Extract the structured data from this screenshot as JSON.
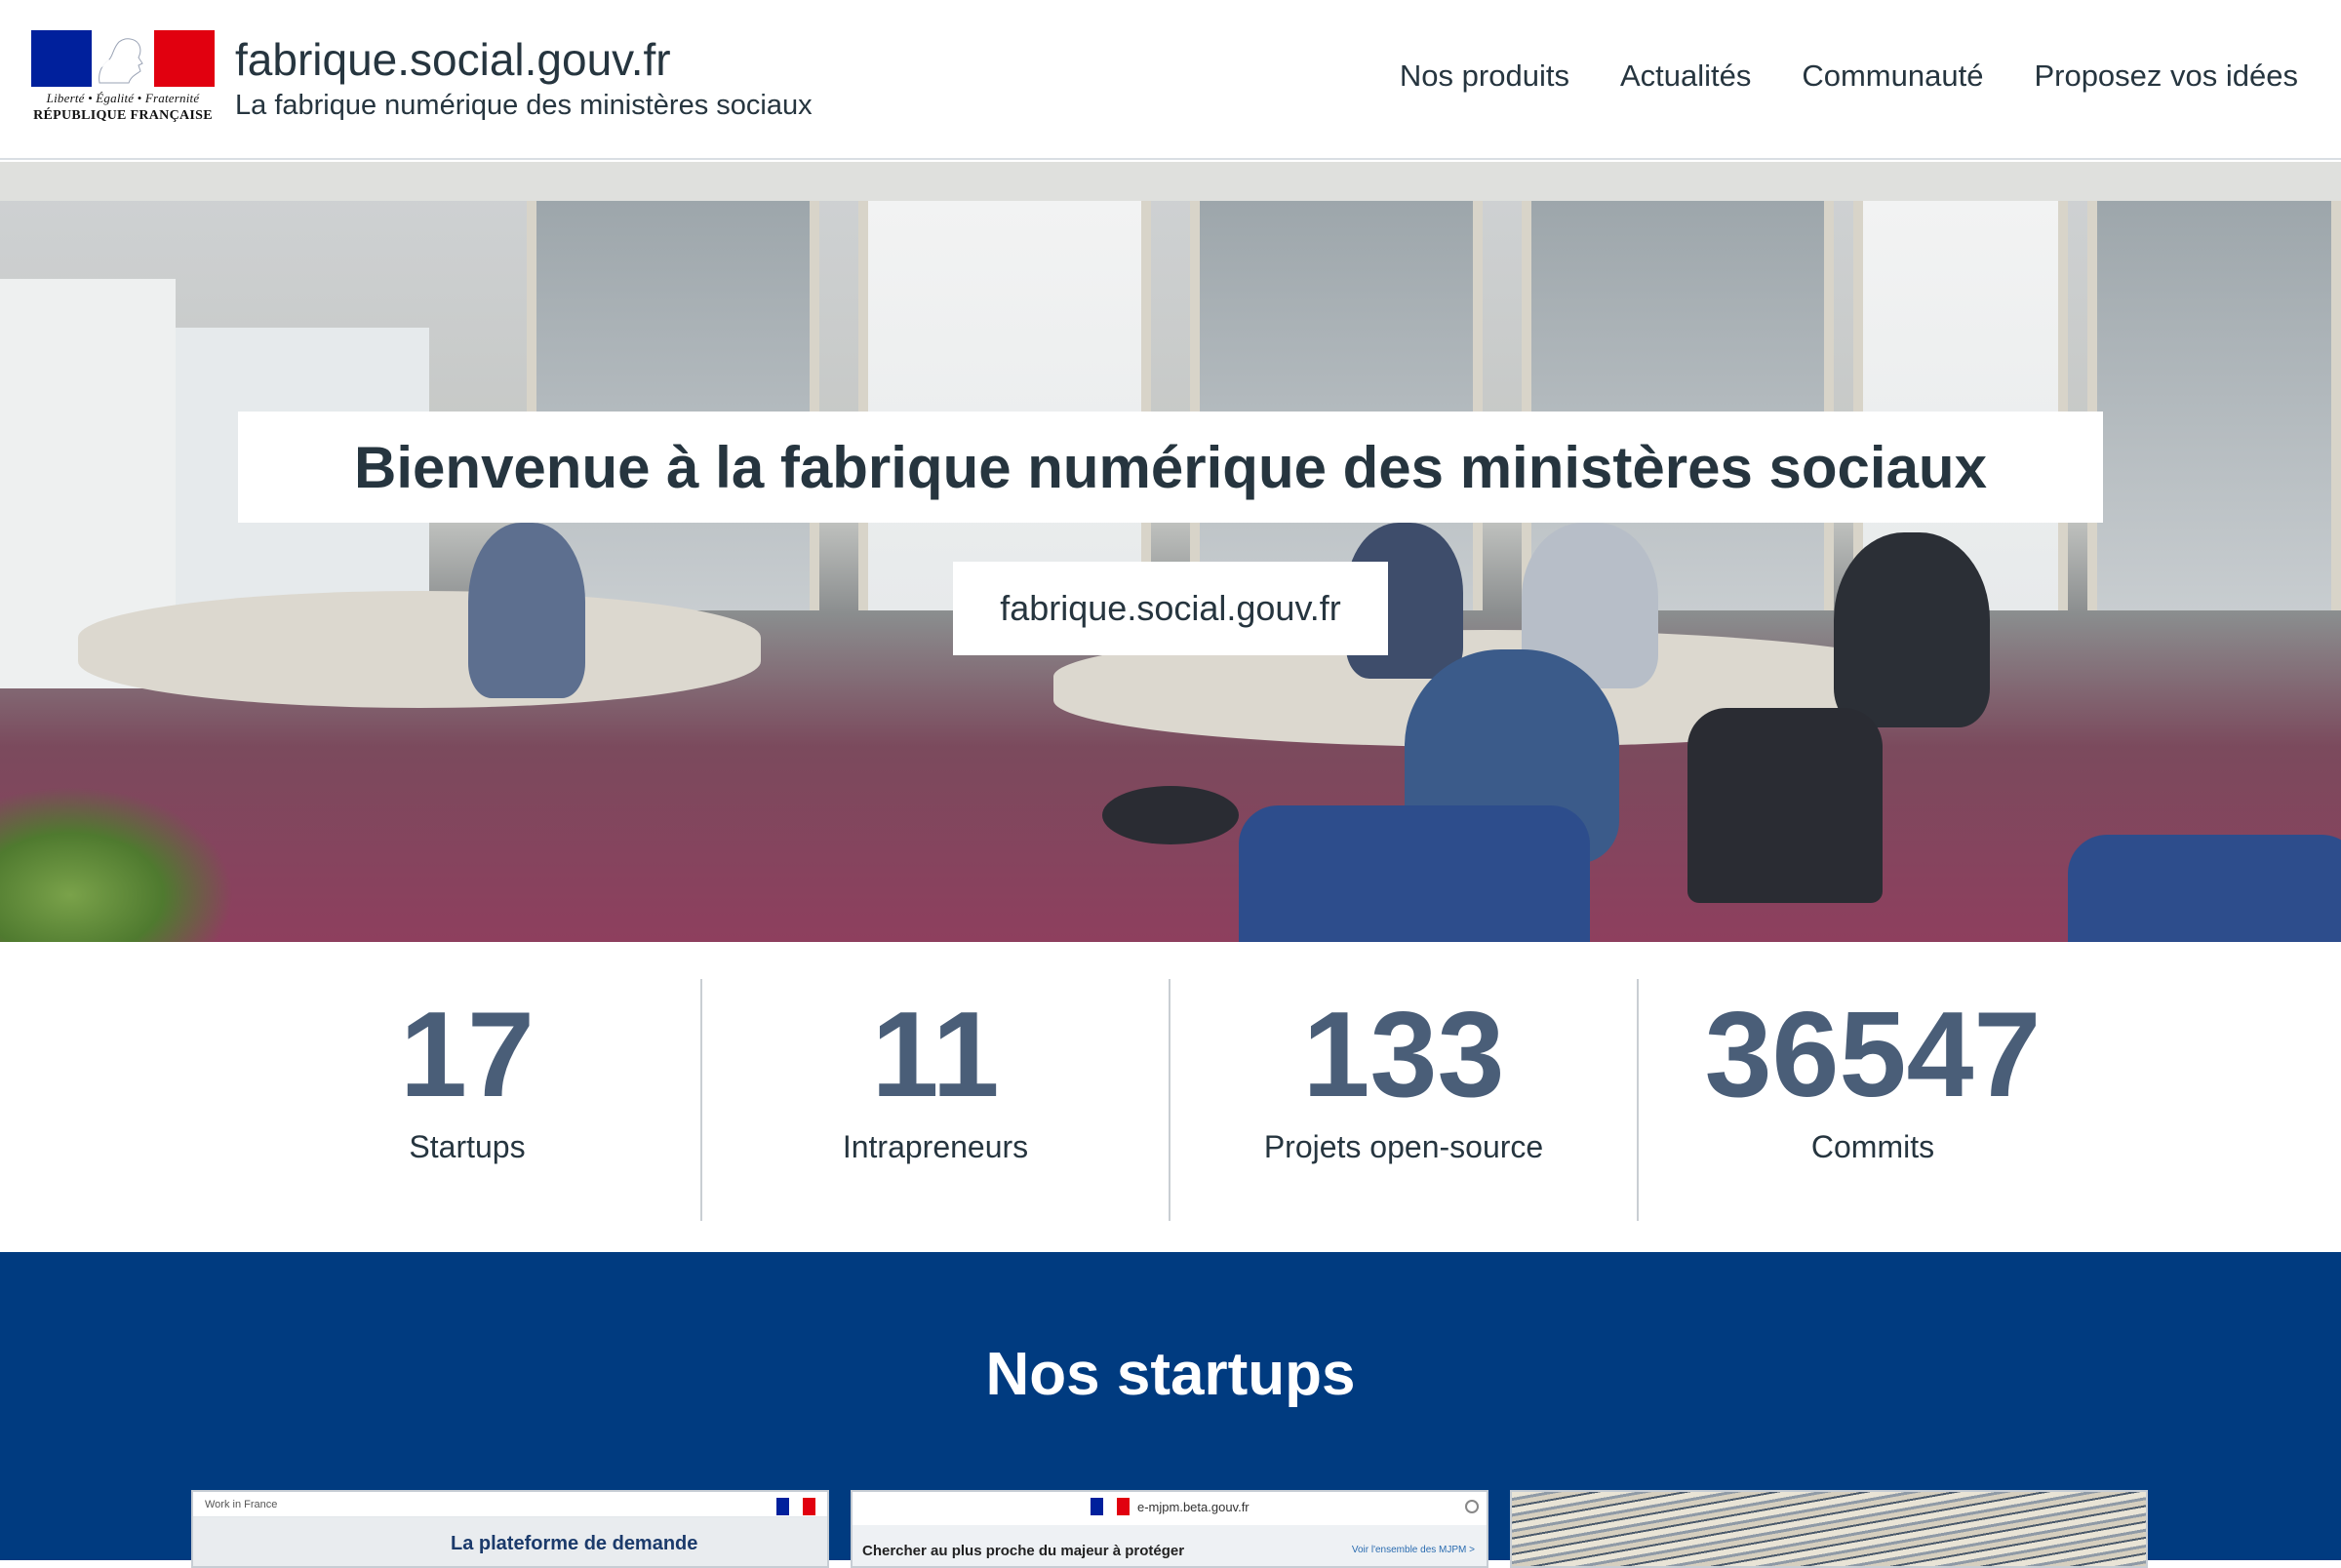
{
  "header": {
    "logo": {
      "devise": "Liberté • Égalité • Fraternité",
      "republique": "RÉPUBLIQUE FRANÇAISE"
    },
    "site_title": "fabrique.social.gouv.fr",
    "site_subtitle": "La fabrique numérique des ministères sociaux",
    "nav": [
      {
        "label": "Nos produits"
      },
      {
        "label": "Actualités"
      },
      {
        "label": "Communauté"
      },
      {
        "label": "Proposez vos idées"
      }
    ]
  },
  "hero": {
    "title": "Bienvenue à la fabrique numérique des ministères sociaux",
    "url_label": "fabrique.social.gouv.fr"
  },
  "stats": [
    {
      "value": "17",
      "label": "Startups"
    },
    {
      "value": "11",
      "label": "Intrapreneurs"
    },
    {
      "value": "133",
      "label": "Projets open-source"
    },
    {
      "value": "36547",
      "label": "Commits"
    }
  ],
  "startups": {
    "title": "Nos startups",
    "cards": [
      {
        "top_label": "Work in France",
        "headline": "La plateforme de demande"
      },
      {
        "top_label": "e-mjpm.beta.gouv.fr",
        "headline": "Chercher au plus proche du majeur à protéger",
        "link": "Voir l'ensemble des MJPM >"
      },
      {
        "top_label": "",
        "headline": ""
      }
    ]
  },
  "colors": {
    "text": "#26353f",
    "stat_number": "#4a5e78",
    "startups_bg": "#003b80",
    "flag_blue": "#00209c",
    "flag_red": "#e1000f"
  }
}
